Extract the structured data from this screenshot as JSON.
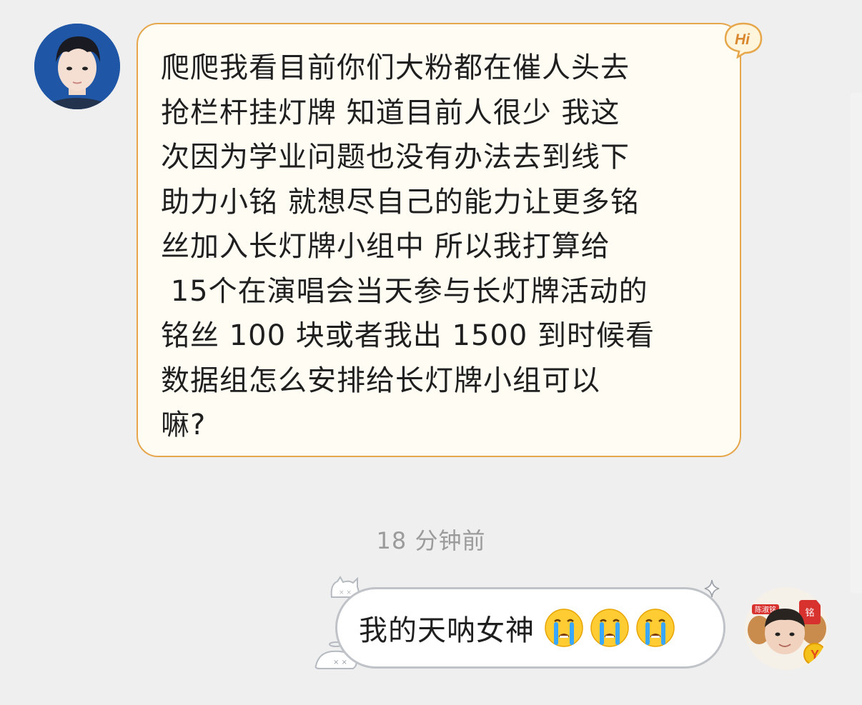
{
  "conversation": {
    "incoming_message": "爬爬我看目前你们大粉都在催人头去\n抢栏杆挂灯牌 知道目前人很少 我这\n次因为学业问题也没有办法去到线下\n助力小铭 就想尽自己的能力让更多铭\n丝加入长灯牌小组中 所以我打算给\n 15个在演唱会当天参与长灯牌活动的\n铭丝 100 块或者我出 1500 到时候看\n数据组怎么安排给长灯牌小组可以\n嘛?",
    "badge_text": "Hi",
    "timestamp": "18 分钟前",
    "outgoing_message": "我的天呐女神",
    "outgoing_emojis": [
      "crying-emoji",
      "crying-emoji",
      "crying-emoji"
    ],
    "right_avatar_label": "陈淑铭",
    "right_avatar_badge": "Y"
  },
  "colors": {
    "background": "#efeff0",
    "incoming_bubble": "#fffcf4",
    "incoming_border": "#e6a64a",
    "outgoing_border": "#bfc3c8",
    "timestamp": "#9b9b9b"
  }
}
